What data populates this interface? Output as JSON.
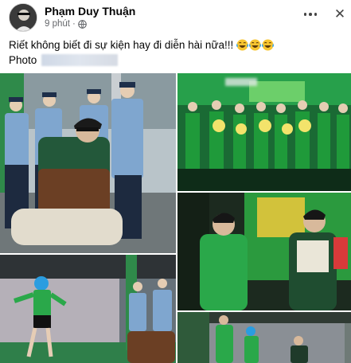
{
  "post": {
    "author": "Phạm Duy Thuận",
    "time": "9 phút",
    "separator": "·",
    "privacy_icon": "globe-icon",
    "caption_text": "Riết không biết đi sự kiện hay đi diễn hài nữa!!!",
    "emojis": [
      "laughing-crying-emoji",
      "laughing-crying-emoji",
      "laughing-crying-emoji"
    ],
    "photo_label": "Photo",
    "more_icon": "more-dots-icon",
    "close_icon": "close-icon",
    "close_glyph": "✕"
  },
  "colors": {
    "brand_green": "#1f9a3a",
    "jacket_green": "#2aa84a",
    "uniform_blue": "#7fa6cf",
    "text_secondary": "#65676b"
  },
  "photos": [
    {
      "name": "photo-guards-crouching-man"
    },
    {
      "name": "photo-stage-group-flowers"
    },
    {
      "name": "photo-green-jacket-duo-screen"
    },
    {
      "name": "photo-dancer-blue-hair"
    },
    {
      "name": "photo-stage-dance-duo"
    }
  ]
}
